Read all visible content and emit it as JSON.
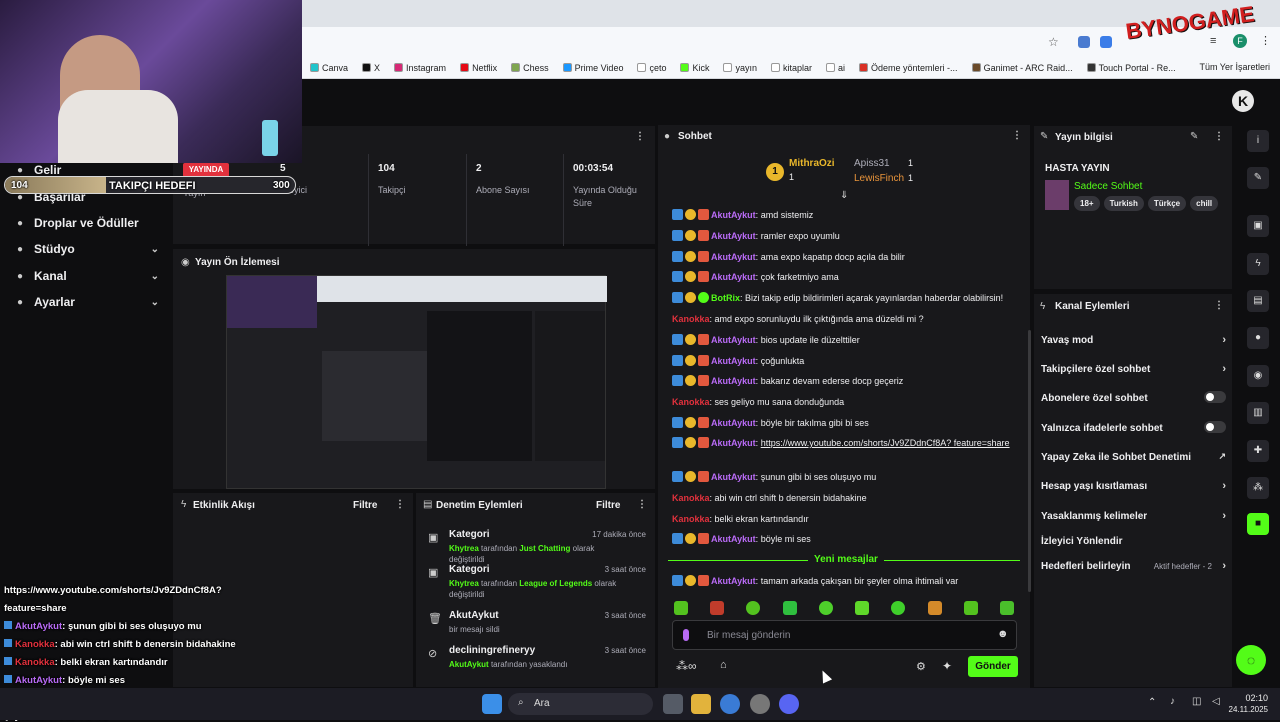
{
  "browser": {
    "bookmarks": [
      {
        "label": "Canva",
        "color": "#20c4cb"
      },
      {
        "label": "X",
        "color": "#111111"
      },
      {
        "label": "Instagram",
        "color": "#d62976"
      },
      {
        "label": "Netflix",
        "color": "#e50914"
      },
      {
        "label": "Chess",
        "color": "#7fa650"
      },
      {
        "label": "Prime Video",
        "color": "#1a98ff"
      },
      {
        "label": "çeto",
        "color": "#ffffff"
      },
      {
        "label": "Kick",
        "color": "#53fc18"
      },
      {
        "label": "yayın",
        "color": "#ffffff"
      },
      {
        "label": "kitaplar",
        "color": "#ffffff"
      },
      {
        "label": "ai",
        "color": "#ffffff"
      },
      {
        "label": "Ödeme yöntemleri -...",
        "color": "#d93025"
      },
      {
        "label": "Ganimet - ARC Raid...",
        "color": "#6b4b2a"
      },
      {
        "label": "Touch Portal - Re...",
        "color": "#333333"
      }
    ],
    "all_bookmarks": "Tüm Yer İşaretleri",
    "avatar_letter": "F"
  },
  "overlay": {
    "goal_current": "104",
    "goal_label": "TAKIPÇI HEDEFI",
    "goal_target": "300",
    "logo_text": "BYNOGAME",
    "chat_lines": [
      {
        "user": "",
        "text": "https://www.youtube.com/shorts/Jv9ZDdnCf8A?"
      },
      {
        "user": "",
        "text": "feature=share"
      },
      {
        "user": "AkutAykut",
        "text": ": şunun gibi bi ses oluşuyo mu"
      },
      {
        "user": "Kanokka",
        "text": ": abi win ctrl shift b denersin bidahakine"
      },
      {
        "user": "Kanokka",
        "text": ": belki ekran kartındandır"
      },
      {
        "user": "AkutAykut",
        "text": ": böyle mi ses"
      },
      {
        "user": "AkutAykut",
        "text": ": tamam arkada çakışan bir"
      },
      {
        "user": "",
        "text": "şeyler olma ihtimali var"
      }
    ]
  },
  "sidebar": {
    "items": [
      {
        "label": "Gelir",
        "icon": "dollar-icon",
        "chevron": false
      },
      {
        "label": "Başarılar",
        "icon": "trophy-icon",
        "chevron": false
      },
      {
        "label": "Droplar ve Ödüller",
        "icon": "gift-icon",
        "chevron": false
      },
      {
        "label": "Stüdyo",
        "icon": "gear-icon",
        "chevron": true
      },
      {
        "label": "Kanal",
        "icon": "user-icon",
        "chevron": true
      },
      {
        "label": "Ayarlar",
        "icon": "gear-icon",
        "chevron": true
      }
    ]
  },
  "stats": {
    "live_badge": "YAYINDA",
    "items": [
      {
        "value": "5",
        "label": "İzleyici"
      },
      {
        "value": "104",
        "label": "Takipçi"
      },
      {
        "value": "2",
        "label": "Abone Sayısı"
      },
      {
        "value": "00:03:54",
        "label": "Yayında Olduğu Süre"
      }
    ],
    "stream_label": "Yayın"
  },
  "preview": {
    "title": "Yayın Ön İzlemesi"
  },
  "activity": {
    "title": "Etkinlik Akışı",
    "filter": "Filtre"
  },
  "moderation": {
    "title": "Denetim Eylemleri",
    "filter": "Filtre",
    "items": [
      {
        "title": "Kategori",
        "time": "17 dakika önce",
        "actor": "Khytrea",
        "mid": " tarafından ",
        "target": "Just Chatting",
        "end": " olarak değiştirildi"
      },
      {
        "title": "Kategori",
        "time": "3 saat önce",
        "actor": "Khytrea",
        "mid": " tarafından ",
        "target": "League of Legends",
        "end": " olarak değiştirildi"
      },
      {
        "title": "AkutAykut",
        "time": "3 saat önce",
        "actor": "",
        "mid": "bir mesajı sildi",
        "target": "",
        "end": ""
      },
      {
        "title": "decliningrefineryy",
        "time": "3 saat önce",
        "actor": "AkutAykut",
        "mid": " tarafından yasaklandı",
        "target": "",
        "end": ""
      }
    ]
  },
  "chat": {
    "title": "Sohbet",
    "gifters": [
      {
        "name": "MithraOzi",
        "count": "1"
      },
      {
        "name": "Apiss31",
        "count": "1"
      },
      {
        "name": "LewisFinch",
        "count": "1"
      }
    ],
    "messages": [
      {
        "user": "AkutAykut",
        "badges": true,
        "text": "amd sistemiz"
      },
      {
        "user": "AkutAykut",
        "badges": true,
        "text": "ramler expo uyumlu"
      },
      {
        "user": "AkutAykut",
        "badges": true,
        "text": "ama expo kapatıp docp açıla da bilir"
      },
      {
        "user": "AkutAykut",
        "badges": true,
        "text": "çok farketmiyo ama"
      },
      {
        "user": "BotRix",
        "badges": true,
        "text": "Bizi takip edip bildirimleri açarak yayınlardan haberdar olabilirsin!"
      },
      {
        "user": "Kanokka",
        "badges": false,
        "text": "amd expo sorunluydu ilk çıktığında ama düzeldi mi ?"
      },
      {
        "user": "AkutAykut",
        "badges": true,
        "text": "bios update ile düzelttiler"
      },
      {
        "user": "AkutAykut",
        "badges": true,
        "text": "çoğunlukta"
      },
      {
        "user": "AkutAykut",
        "badges": true,
        "text": "bakarız devam ederse docp geçeriz"
      },
      {
        "user": "Kanokka",
        "badges": false,
        "text": "ses geliyo mu sana donduğunda"
      },
      {
        "user": "AkutAykut",
        "badges": true,
        "text": "böyle bir takılma gibi bi ses"
      },
      {
        "user": "AkutAykut",
        "badges": true,
        "text": "https://www.youtube.com/shorts/Jv9ZDdnCf8A? feature=share"
      },
      {
        "user": "AkutAykut",
        "badges": true,
        "text": "şunun gibi bi ses oluşuyo mu"
      },
      {
        "user": "Kanokka",
        "badges": false,
        "text": "abi win ctrl shift b denersin bidahakine"
      },
      {
        "user": "Kanokka",
        "badges": false,
        "text": "belki ekran kartındandır"
      },
      {
        "user": "AkutAykut",
        "badges": true,
        "text": "böyle mi ses"
      }
    ],
    "new_messages": "Yeni mesajlar",
    "last_message": {
      "user": "AkutAykut",
      "text": "tamam arkada çakışan bir şeyler olma ihtimali var"
    },
    "placeholder": "Bir mesaj gönderin",
    "send": "Gönder"
  },
  "stream_info": {
    "title": "Yayın bilgisi",
    "stream_title": "HASTA YAYIN",
    "category": "Sadece Sohbet",
    "tags": [
      "18+",
      "Turkish",
      "Türkçe",
      "chill"
    ]
  },
  "channel_actions": {
    "title": "Kanal Eylemleri",
    "items": [
      {
        "label": "Yavaş mod",
        "control": "chevron",
        "extra": ""
      },
      {
        "label": "Takipçilere özel sohbet",
        "control": "chevron",
        "extra": ""
      },
      {
        "label": "Abonelere özel sohbet",
        "control": "toggle",
        "extra": ""
      },
      {
        "label": "Yalnızca ifadelerle sohbet",
        "control": "toggle",
        "extra": ""
      },
      {
        "label": "Yapay Zeka ile Sohbet Denetimi",
        "control": "external",
        "extra": ""
      },
      {
        "label": "Hesap yaşı kısıtlaması",
        "control": "chevron",
        "extra": ""
      },
      {
        "label": "Yasaklanmış kelimeler",
        "control": "chevron",
        "extra": ""
      },
      {
        "label": "İzleyici Yönlendir",
        "control": "none",
        "extra": ""
      },
      {
        "label": "Hedefleri belirleyin",
        "control": "chevron",
        "extra": "Aktif hedefler - 2"
      }
    ]
  },
  "taskbar": {
    "search": "Ara",
    "time": "02:10",
    "date": "24.11.2025"
  },
  "colors": {
    "accent": "#53fc18",
    "chat_user": "#b96bf6",
    "mod_user": "#e2313d"
  }
}
